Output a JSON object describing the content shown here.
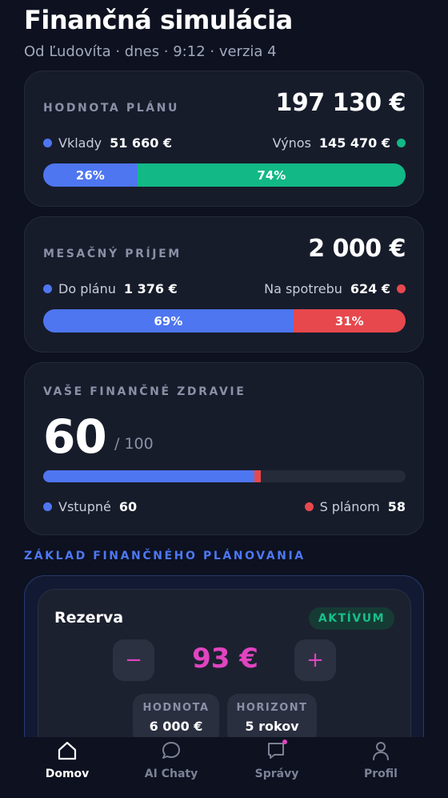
{
  "header": {
    "title": "Finančná simulácia",
    "subtitle": "Od Ľudovíta · dnes · 9:12 · verzia 4"
  },
  "plan_value": {
    "label": "HODNOTA PLÁNU",
    "total": "197 130 €",
    "left_label": "Vklady",
    "left_value": "51 660 €",
    "right_label": "Výnos",
    "right_value": "145 470 €",
    "left_pct_text": "26%",
    "right_pct_text": "74%",
    "left_pct": 26,
    "right_pct": 74,
    "left_color": "#4e76f0",
    "right_color": "#12b886"
  },
  "monthly_income": {
    "label": "MESAČNÝ PRÍJEM",
    "total": "2 000 €",
    "left_label": "Do plánu",
    "left_value": "1 376 €",
    "right_label": "Na spotrebu",
    "right_value": "624 €",
    "left_pct_text": "69%",
    "right_pct_text": "31%",
    "left_pct": 69,
    "right_pct": 31,
    "left_color": "#4e76f0",
    "right_color": "#e7484d"
  },
  "financial_health": {
    "label": "VAŠE FINANČNÉ ZDRAVIE",
    "score": "60",
    "max": "/ 100",
    "entry_label": "Vstupné",
    "entry_value": "60",
    "plan_label": "S plánom",
    "plan_value": "58",
    "entry_level": 0.6,
    "plan_level": 0.58
  },
  "section": {
    "title": "ZÁKLAD FINANČNÉHO PLÁNOVANIA"
  },
  "reserve": {
    "name": "Rezerva",
    "status": "AKTÍVUM",
    "amount": "93 €",
    "minus": "−",
    "plus": "+",
    "value_label": "HODNOTA",
    "value": "6 000 €",
    "horizon_label": "HORIZONT",
    "horizon": "5 rokov"
  },
  "nav": {
    "items": [
      {
        "label": "Domov",
        "icon": "home-icon",
        "active": true
      },
      {
        "label": "AI Chaty",
        "icon": "chat-bubble-icon",
        "active": false
      },
      {
        "label": "Správy",
        "icon": "message-icon",
        "active": false
      },
      {
        "label": "Profil",
        "icon": "person-icon",
        "active": false
      }
    ]
  },
  "colors": {
    "background": "#0d1120",
    "accent_blue": "#4e76f0",
    "accent_green": "#12b886",
    "accent_red": "#e7484d",
    "accent_magenta": "#e044c0"
  }
}
